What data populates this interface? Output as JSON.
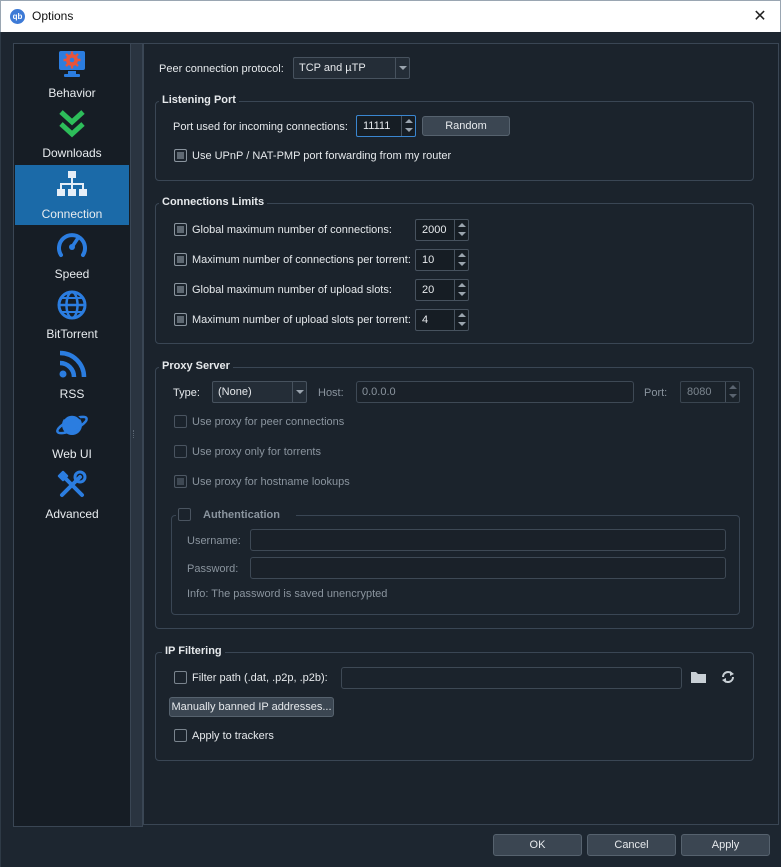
{
  "window": {
    "title": "Options",
    "app_icon": "qb"
  },
  "sidebar": {
    "items": [
      {
        "label": "Behavior",
        "icon": "monitor-gear-icon",
        "active": false
      },
      {
        "label": "Downloads",
        "icon": "double-chevron-down-icon",
        "active": false
      },
      {
        "label": "Connection",
        "icon": "network-icon",
        "active": true
      },
      {
        "label": "Speed",
        "icon": "speedometer-icon",
        "active": false
      },
      {
        "label": "BitTorrent",
        "icon": "globe-icon",
        "active": false
      },
      {
        "label": "RSS",
        "icon": "rss-icon",
        "active": false
      },
      {
        "label": "Web UI",
        "icon": "planet-icon",
        "active": false
      },
      {
        "label": "Advanced",
        "icon": "tools-icon",
        "active": false
      }
    ]
  },
  "connection": {
    "protocol_label": "Peer connection protocol:",
    "protocol_value": "TCP and µTP",
    "listening": {
      "title": "Listening Port",
      "port_label": "Port used for incoming connections:",
      "port_value": "11111",
      "random_label": "Random",
      "upnp_label": "Use UPnP / NAT-PMP port forwarding from my router"
    },
    "limits": {
      "title": "Connections Limits",
      "rows": [
        {
          "label": "Global maximum number of connections:",
          "value": "2000"
        },
        {
          "label": "Maximum number of connections per torrent:",
          "value": "10"
        },
        {
          "label": "Global maximum number of upload slots:",
          "value": "20"
        },
        {
          "label": "Maximum number of upload slots per torrent:",
          "value": "4"
        }
      ]
    },
    "proxy": {
      "title": "Proxy Server",
      "type_label": "Type:",
      "type_value": "(None)",
      "host_label": "Host:",
      "host_value": "0.0.0.0",
      "port_label": "Port:",
      "port_value": "8080",
      "peer_label": "Use proxy for peer connections",
      "torrents_label": "Use proxy only for torrents",
      "hostname_label": "Use proxy for hostname lookups",
      "auth_title": "Authentication",
      "username_label": "Username:",
      "password_label": "Password:",
      "info": "Info: The password is saved unencrypted"
    },
    "ipfilter": {
      "title": "IP Filtering",
      "filter_label": "Filter path (.dat, .p2p, .p2b):",
      "filter_value": "",
      "banned_label": "Manually banned IP addresses...",
      "trackers_label": "Apply to trackers"
    }
  },
  "footer": {
    "ok": "OK",
    "cancel": "Cancel",
    "apply": "Apply"
  }
}
